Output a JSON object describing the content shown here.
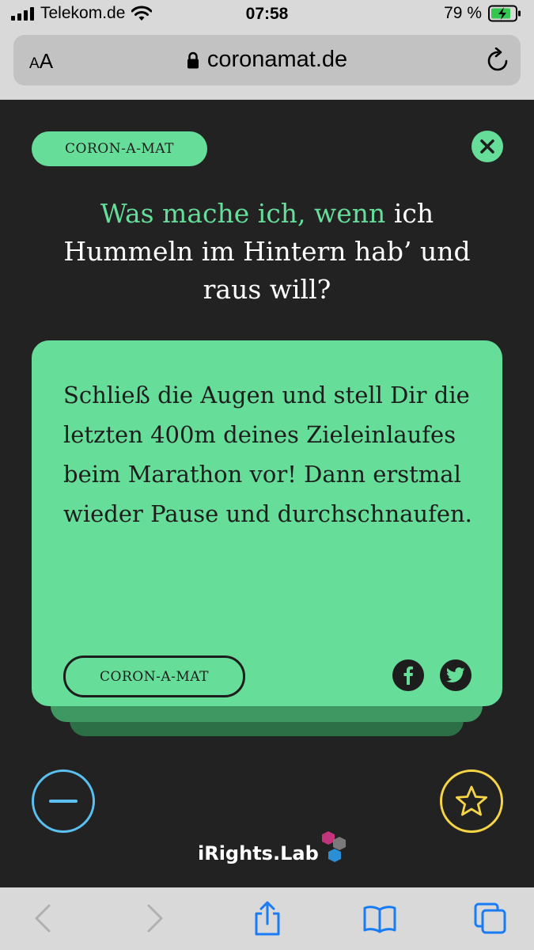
{
  "status": {
    "carrier": "Telekom.de",
    "time": "07:58",
    "battery": "79 %"
  },
  "browser": {
    "text_size_label_small": "A",
    "text_size_label_large": "A",
    "domain": "coronamat.de"
  },
  "header": {
    "pill_label": "CORON-A-MAT"
  },
  "question": {
    "accent": "Was mache ich, wenn",
    "rest": "ich Hummeln im Hintern hab’ und raus will?"
  },
  "card": {
    "answer": "Schließ die Augen und stell Dir die letzten 400m deines Zieleinlaufes beim Marathon vor! Dann erstmal wieder Pause und durchschnaufen.",
    "pill_label": "CORON-A-MAT"
  },
  "brand": {
    "logo_text": "iRights.Lab"
  },
  "colors": {
    "accent": "#66dd99",
    "background": "#222222",
    "minus": "#5bc0f0",
    "star": "#f5d547",
    "toolbar_blue": "#1a7cf5"
  },
  "icons": [
    "signal-icon",
    "wifi-icon",
    "battery-icon",
    "lock-icon",
    "reload-icon",
    "close-icon",
    "facebook-icon",
    "twitter-icon",
    "minus-icon",
    "star-icon",
    "back-icon",
    "forward-icon",
    "share-icon",
    "bookmarks-icon",
    "tabs-icon"
  ]
}
